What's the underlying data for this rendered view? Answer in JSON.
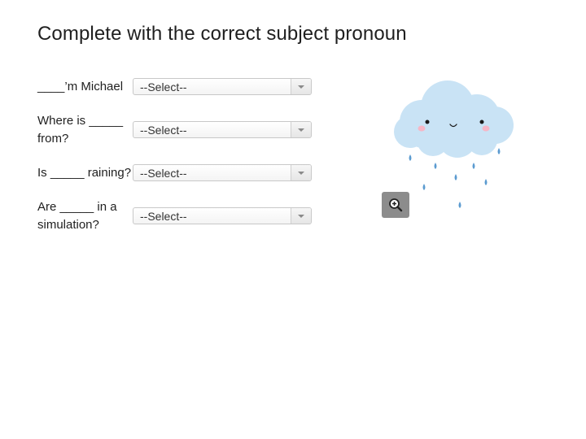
{
  "title": "Complete with the correct subject pronoun",
  "questions": [
    {
      "text": "____’m Michael",
      "selected": "--Select--"
    },
    {
      "text": "Where is _____ from?",
      "selected": "--Select--"
    },
    {
      "text": "Is _____ raining?",
      "selected": "--Select--"
    },
    {
      "text": "Are _____ in a simulation?",
      "selected": "--Select--"
    }
  ],
  "icons": {
    "zoom": "zoom-in-icon",
    "illustration": "rain-cloud-illustration",
    "dropdown": "chevron-down-icon"
  },
  "colors": {
    "cloud": "#c9e3f5",
    "raindrop": "#5b9bd0",
    "zoom_button": "#8c8c8c"
  }
}
